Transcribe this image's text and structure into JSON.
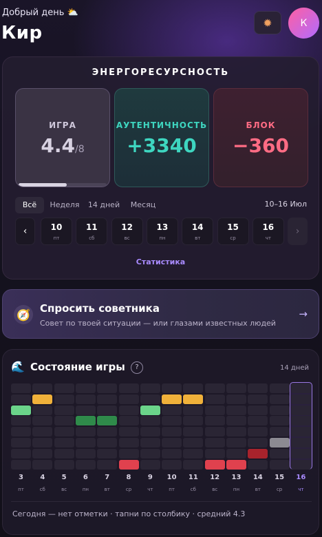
{
  "header": {
    "greeting": "Добрый день",
    "greeting_icon": "sun-behind-cloud-icon",
    "user_name": "Кир",
    "avatar_initial": "К"
  },
  "energy": {
    "title": "ЭНЕРГОРЕСУРСНОСТЬ",
    "tiles": {
      "game": {
        "label": "ИГРА",
        "value": "4.4",
        "max": "/8",
        "progress": 0.55
      },
      "auth": {
        "label": "АУТЕНТИЧНОСТЬ",
        "value": "+3340"
      },
      "block": {
        "label": "БЛОК",
        "value": "−360"
      }
    },
    "periods": [
      "Всё",
      "Неделя",
      "14 дней",
      "Месяц"
    ],
    "active_period": "Всё",
    "date_range": "10–16 Июл",
    "days": [
      {
        "n": "10",
        "w": "пт"
      },
      {
        "n": "11",
        "w": "сб"
      },
      {
        "n": "12",
        "w": "вс"
      },
      {
        "n": "13",
        "w": "пн"
      },
      {
        "n": "14",
        "w": "вт"
      },
      {
        "n": "15",
        "w": "ср"
      },
      {
        "n": "16",
        "w": "чт"
      }
    ],
    "prev_label": "‹",
    "next_label": "›",
    "stats_link": "Статистика"
  },
  "advisor": {
    "title": "Спросить советника",
    "subtitle": "Совет по твоей ситуации — или глазами известных людей",
    "icon": "compass-icon",
    "arrow": "→"
  },
  "state": {
    "title": "Состояние игры",
    "icon": "wave-icon",
    "help": "?",
    "range_label": "14 дней",
    "days": [
      {
        "n": "3",
        "w": "пт"
      },
      {
        "n": "4",
        "w": "сб"
      },
      {
        "n": "5",
        "w": "вс"
      },
      {
        "n": "6",
        "w": "пн"
      },
      {
        "n": "7",
        "w": "вт"
      },
      {
        "n": "8",
        "w": "ср"
      },
      {
        "n": "9",
        "w": "чт"
      },
      {
        "n": "10",
        "w": "пт"
      },
      {
        "n": "11",
        "w": "сб"
      },
      {
        "n": "12",
        "w": "вс"
      },
      {
        "n": "13",
        "w": "пн"
      },
      {
        "n": "14",
        "w": "вт"
      },
      {
        "n": "15",
        "w": "ср"
      },
      {
        "n": "16",
        "w": "чт"
      }
    ],
    "marks": [
      {
        "day": 0,
        "level": 2,
        "color": "#6bd48a"
      },
      {
        "day": 1,
        "level": 1,
        "color": "#f0b13a"
      },
      {
        "day": 3,
        "level": 3,
        "color": "#2f8a4a"
      },
      {
        "day": 4,
        "level": 3,
        "color": "#2f8a4a"
      },
      {
        "day": 5,
        "level": 7,
        "color": "#e0414e"
      },
      {
        "day": 6,
        "level": 2,
        "color": "#6bd48a"
      },
      {
        "day": 7,
        "level": 1,
        "color": "#f0b13a"
      },
      {
        "day": 8,
        "level": 1,
        "color": "#f0b13a"
      },
      {
        "day": 9,
        "level": 7,
        "color": "#e0414e"
      },
      {
        "day": 10,
        "level": 7,
        "color": "#e0414e"
      },
      {
        "day": 11,
        "level": 6,
        "color": "#a8232c"
      },
      {
        "day": 12,
        "level": 5,
        "color": "#8c8a92"
      }
    ],
    "highlight_day": 13,
    "footer": "Сегодня — нет отметки · тапни по столбику · средний 4.3"
  }
}
